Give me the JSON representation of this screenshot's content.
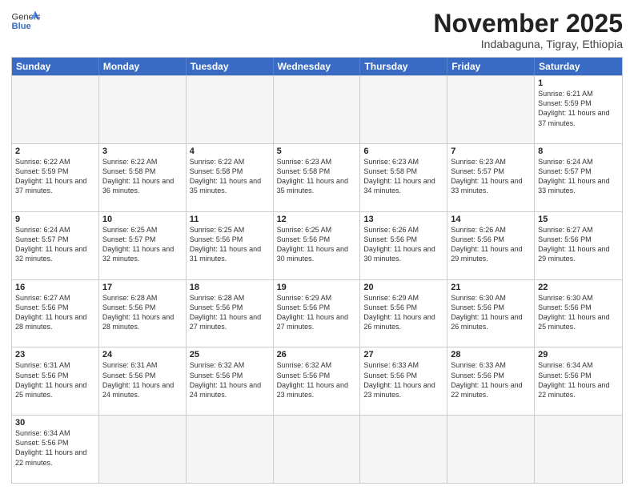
{
  "header": {
    "logo_general": "General",
    "logo_blue": "Blue",
    "month_title": "November 2025",
    "subtitle": "Indabaguna, Tigray, Ethiopia"
  },
  "weekdays": [
    "Sunday",
    "Monday",
    "Tuesday",
    "Wednesday",
    "Thursday",
    "Friday",
    "Saturday"
  ],
  "rows": [
    [
      {
        "day": "",
        "info": ""
      },
      {
        "day": "",
        "info": ""
      },
      {
        "day": "",
        "info": ""
      },
      {
        "day": "",
        "info": ""
      },
      {
        "day": "",
        "info": ""
      },
      {
        "day": "",
        "info": ""
      },
      {
        "day": "1",
        "info": "Sunrise: 6:21 AM\nSunset: 5:59 PM\nDaylight: 11 hours and 37 minutes."
      }
    ],
    [
      {
        "day": "2",
        "info": "Sunrise: 6:22 AM\nSunset: 5:59 PM\nDaylight: 11 hours and 37 minutes."
      },
      {
        "day": "3",
        "info": "Sunrise: 6:22 AM\nSunset: 5:58 PM\nDaylight: 11 hours and 36 minutes."
      },
      {
        "day": "4",
        "info": "Sunrise: 6:22 AM\nSunset: 5:58 PM\nDaylight: 11 hours and 35 minutes."
      },
      {
        "day": "5",
        "info": "Sunrise: 6:23 AM\nSunset: 5:58 PM\nDaylight: 11 hours and 35 minutes."
      },
      {
        "day": "6",
        "info": "Sunrise: 6:23 AM\nSunset: 5:58 PM\nDaylight: 11 hours and 34 minutes."
      },
      {
        "day": "7",
        "info": "Sunrise: 6:23 AM\nSunset: 5:57 PM\nDaylight: 11 hours and 33 minutes."
      },
      {
        "day": "8",
        "info": "Sunrise: 6:24 AM\nSunset: 5:57 PM\nDaylight: 11 hours and 33 minutes."
      }
    ],
    [
      {
        "day": "9",
        "info": "Sunrise: 6:24 AM\nSunset: 5:57 PM\nDaylight: 11 hours and 32 minutes."
      },
      {
        "day": "10",
        "info": "Sunrise: 6:25 AM\nSunset: 5:57 PM\nDaylight: 11 hours and 32 minutes."
      },
      {
        "day": "11",
        "info": "Sunrise: 6:25 AM\nSunset: 5:56 PM\nDaylight: 11 hours and 31 minutes."
      },
      {
        "day": "12",
        "info": "Sunrise: 6:25 AM\nSunset: 5:56 PM\nDaylight: 11 hours and 30 minutes."
      },
      {
        "day": "13",
        "info": "Sunrise: 6:26 AM\nSunset: 5:56 PM\nDaylight: 11 hours and 30 minutes."
      },
      {
        "day": "14",
        "info": "Sunrise: 6:26 AM\nSunset: 5:56 PM\nDaylight: 11 hours and 29 minutes."
      },
      {
        "day": "15",
        "info": "Sunrise: 6:27 AM\nSunset: 5:56 PM\nDaylight: 11 hours and 29 minutes."
      }
    ],
    [
      {
        "day": "16",
        "info": "Sunrise: 6:27 AM\nSunset: 5:56 PM\nDaylight: 11 hours and 28 minutes."
      },
      {
        "day": "17",
        "info": "Sunrise: 6:28 AM\nSunset: 5:56 PM\nDaylight: 11 hours and 28 minutes."
      },
      {
        "day": "18",
        "info": "Sunrise: 6:28 AM\nSunset: 5:56 PM\nDaylight: 11 hours and 27 minutes."
      },
      {
        "day": "19",
        "info": "Sunrise: 6:29 AM\nSunset: 5:56 PM\nDaylight: 11 hours and 27 minutes."
      },
      {
        "day": "20",
        "info": "Sunrise: 6:29 AM\nSunset: 5:56 PM\nDaylight: 11 hours and 26 minutes."
      },
      {
        "day": "21",
        "info": "Sunrise: 6:30 AM\nSunset: 5:56 PM\nDaylight: 11 hours and 26 minutes."
      },
      {
        "day": "22",
        "info": "Sunrise: 6:30 AM\nSunset: 5:56 PM\nDaylight: 11 hours and 25 minutes."
      }
    ],
    [
      {
        "day": "23",
        "info": "Sunrise: 6:31 AM\nSunset: 5:56 PM\nDaylight: 11 hours and 25 minutes."
      },
      {
        "day": "24",
        "info": "Sunrise: 6:31 AM\nSunset: 5:56 PM\nDaylight: 11 hours and 24 minutes."
      },
      {
        "day": "25",
        "info": "Sunrise: 6:32 AM\nSunset: 5:56 PM\nDaylight: 11 hours and 24 minutes."
      },
      {
        "day": "26",
        "info": "Sunrise: 6:32 AM\nSunset: 5:56 PM\nDaylight: 11 hours and 23 minutes."
      },
      {
        "day": "27",
        "info": "Sunrise: 6:33 AM\nSunset: 5:56 PM\nDaylight: 11 hours and 23 minutes."
      },
      {
        "day": "28",
        "info": "Sunrise: 6:33 AM\nSunset: 5:56 PM\nDaylight: 11 hours and 22 minutes."
      },
      {
        "day": "29",
        "info": "Sunrise: 6:34 AM\nSunset: 5:56 PM\nDaylight: 11 hours and 22 minutes."
      }
    ],
    [
      {
        "day": "30",
        "info": "Sunrise: 6:34 AM\nSunset: 5:56 PM\nDaylight: 11 hours and 22 minutes."
      },
      {
        "day": "",
        "info": ""
      },
      {
        "day": "",
        "info": ""
      },
      {
        "day": "",
        "info": ""
      },
      {
        "day": "",
        "info": ""
      },
      {
        "day": "",
        "info": ""
      },
      {
        "day": "",
        "info": ""
      }
    ]
  ]
}
